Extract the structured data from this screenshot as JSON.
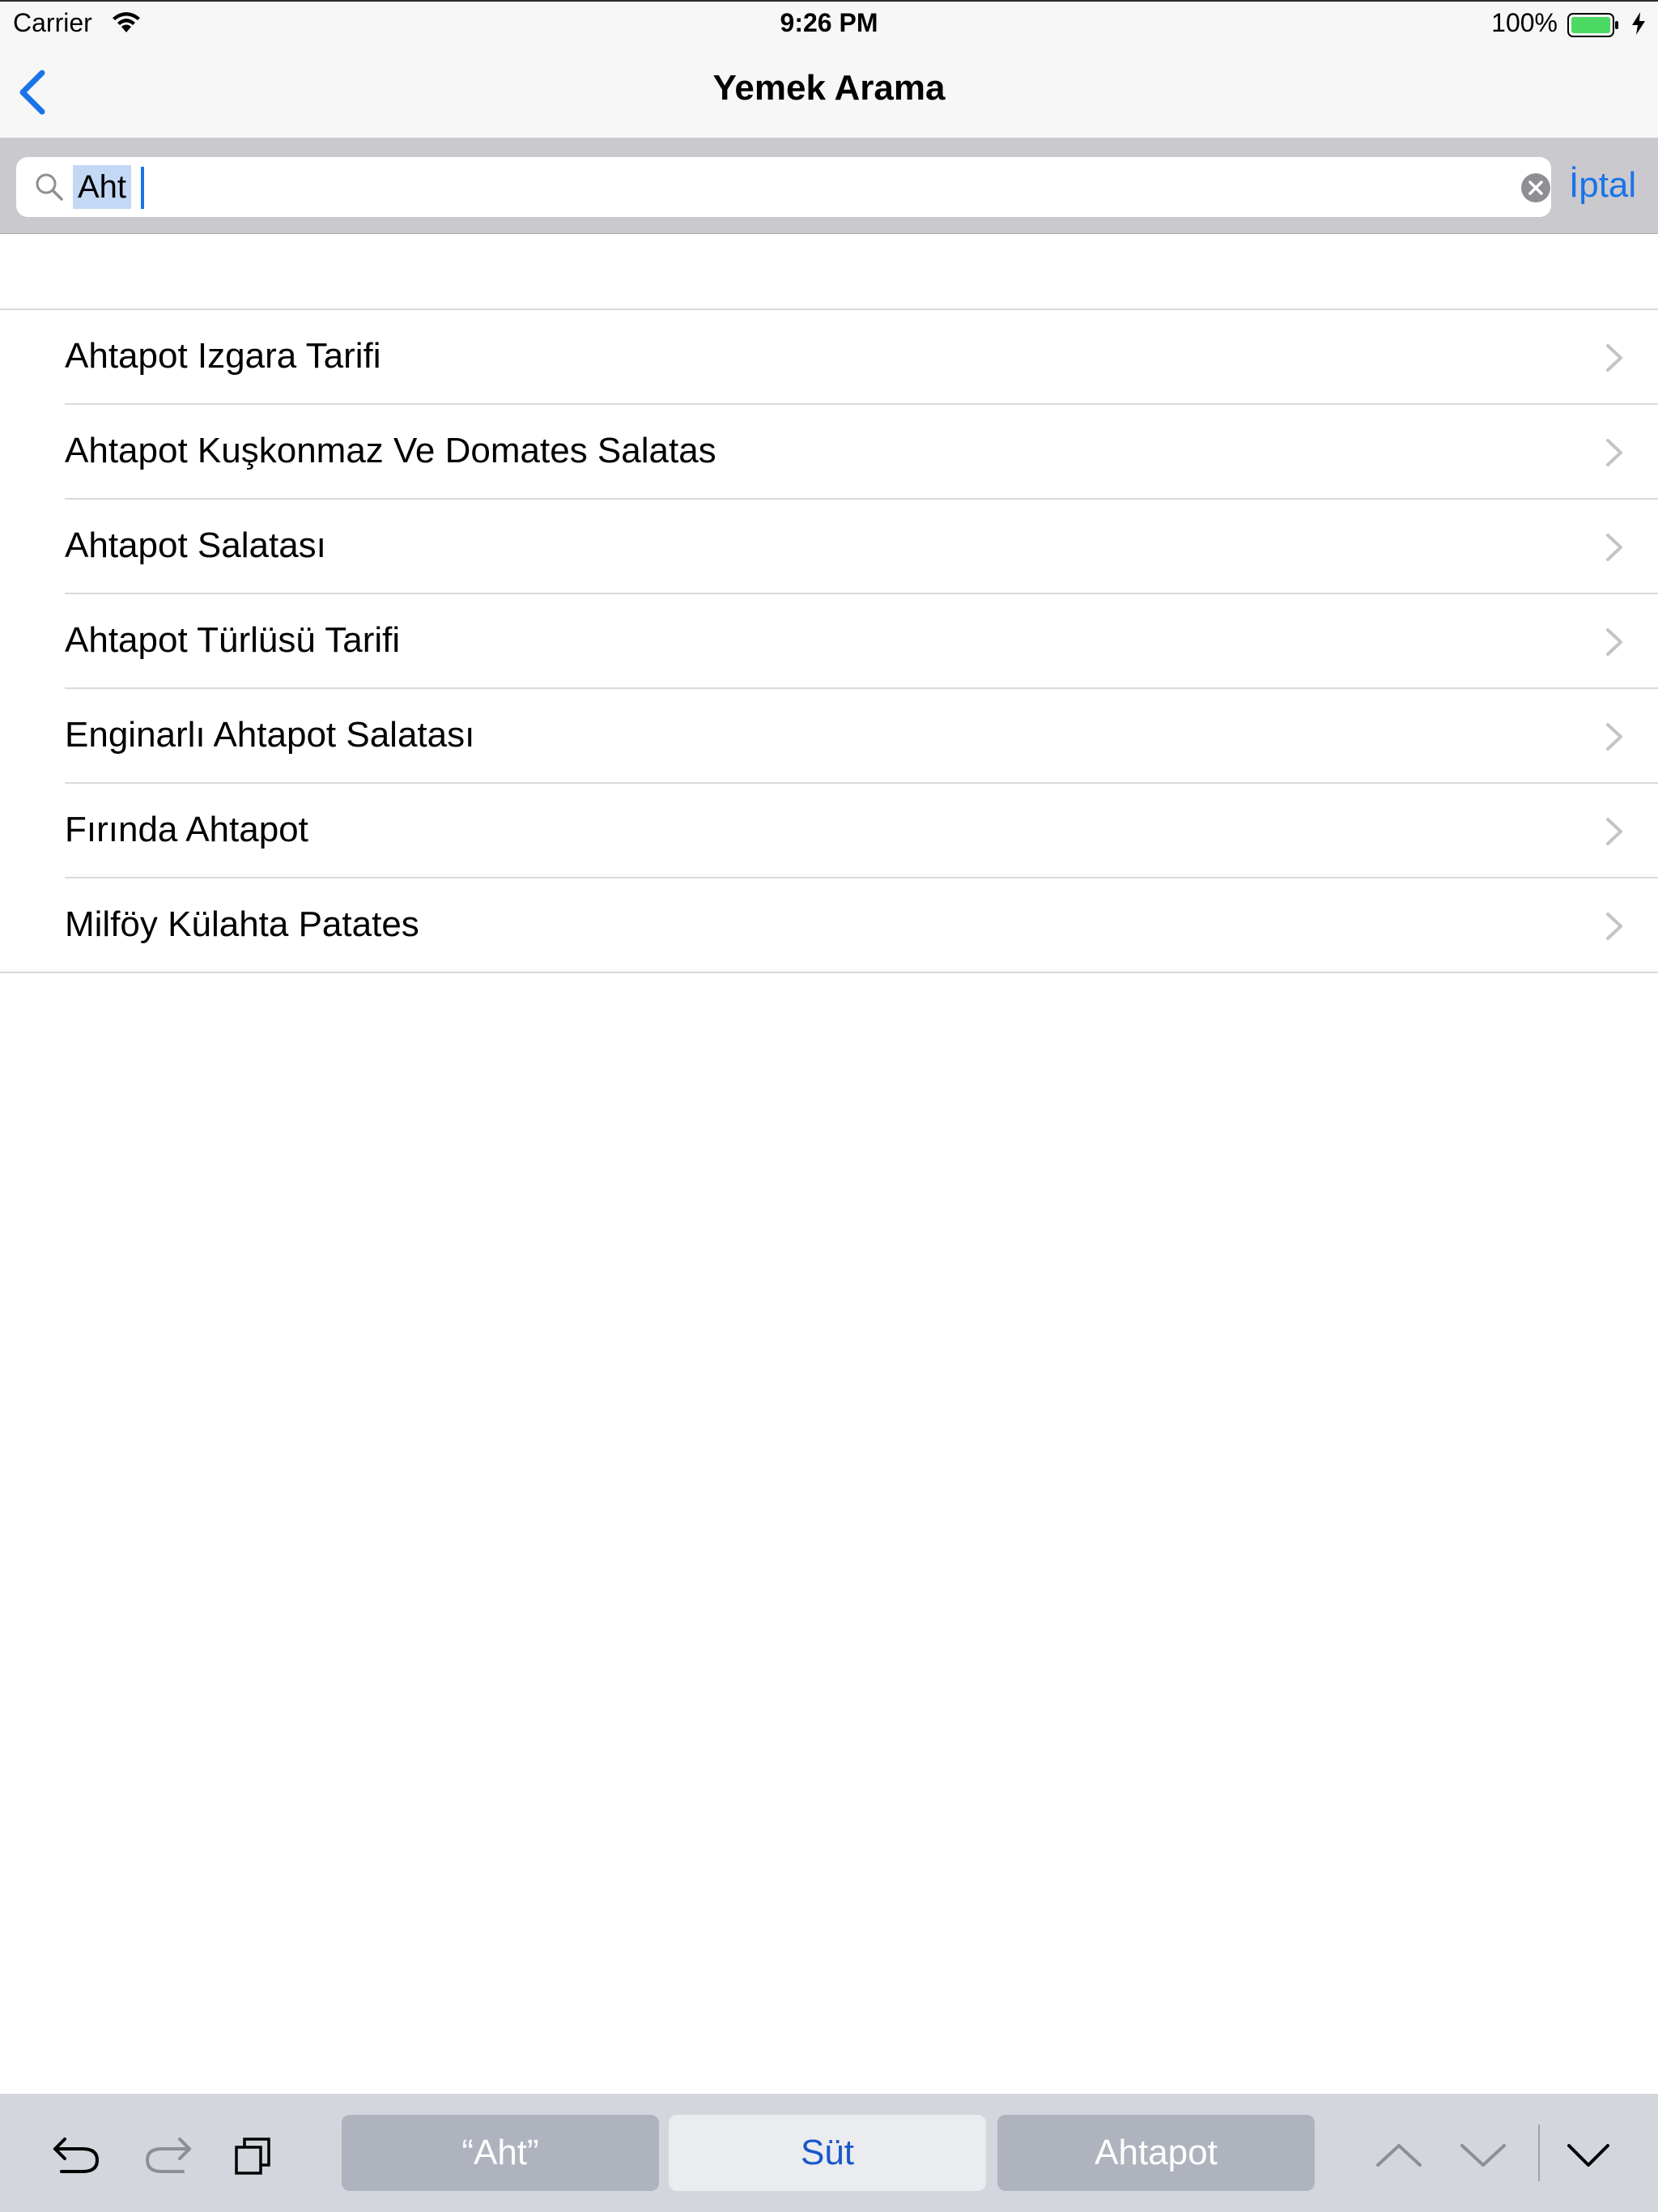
{
  "status_bar": {
    "carrier": "Carrier",
    "time": "9:26 PM",
    "battery": "100%"
  },
  "nav": {
    "title": "Yemek Arama"
  },
  "search": {
    "query": "Aht",
    "cancel_label": "İptal"
  },
  "results": [
    "Ahtapot Izgara Tarifi",
    "Ahtapot Kuşkonmaz Ve Domates Salatas",
    "Ahtapot Salatası",
    "Ahtapot Türlüsü Tarifi",
    "Enginarlı Ahtapot Salatası",
    "Fırında Ahtapot",
    "Milföy Külahta Patates"
  ],
  "keyboard_bar": {
    "suggestions": [
      "“Aht”",
      "Süt",
      "Ahtapot"
    ]
  },
  "colors": {
    "accent": "#1a73e8",
    "battery_fill": "#4cd964"
  }
}
